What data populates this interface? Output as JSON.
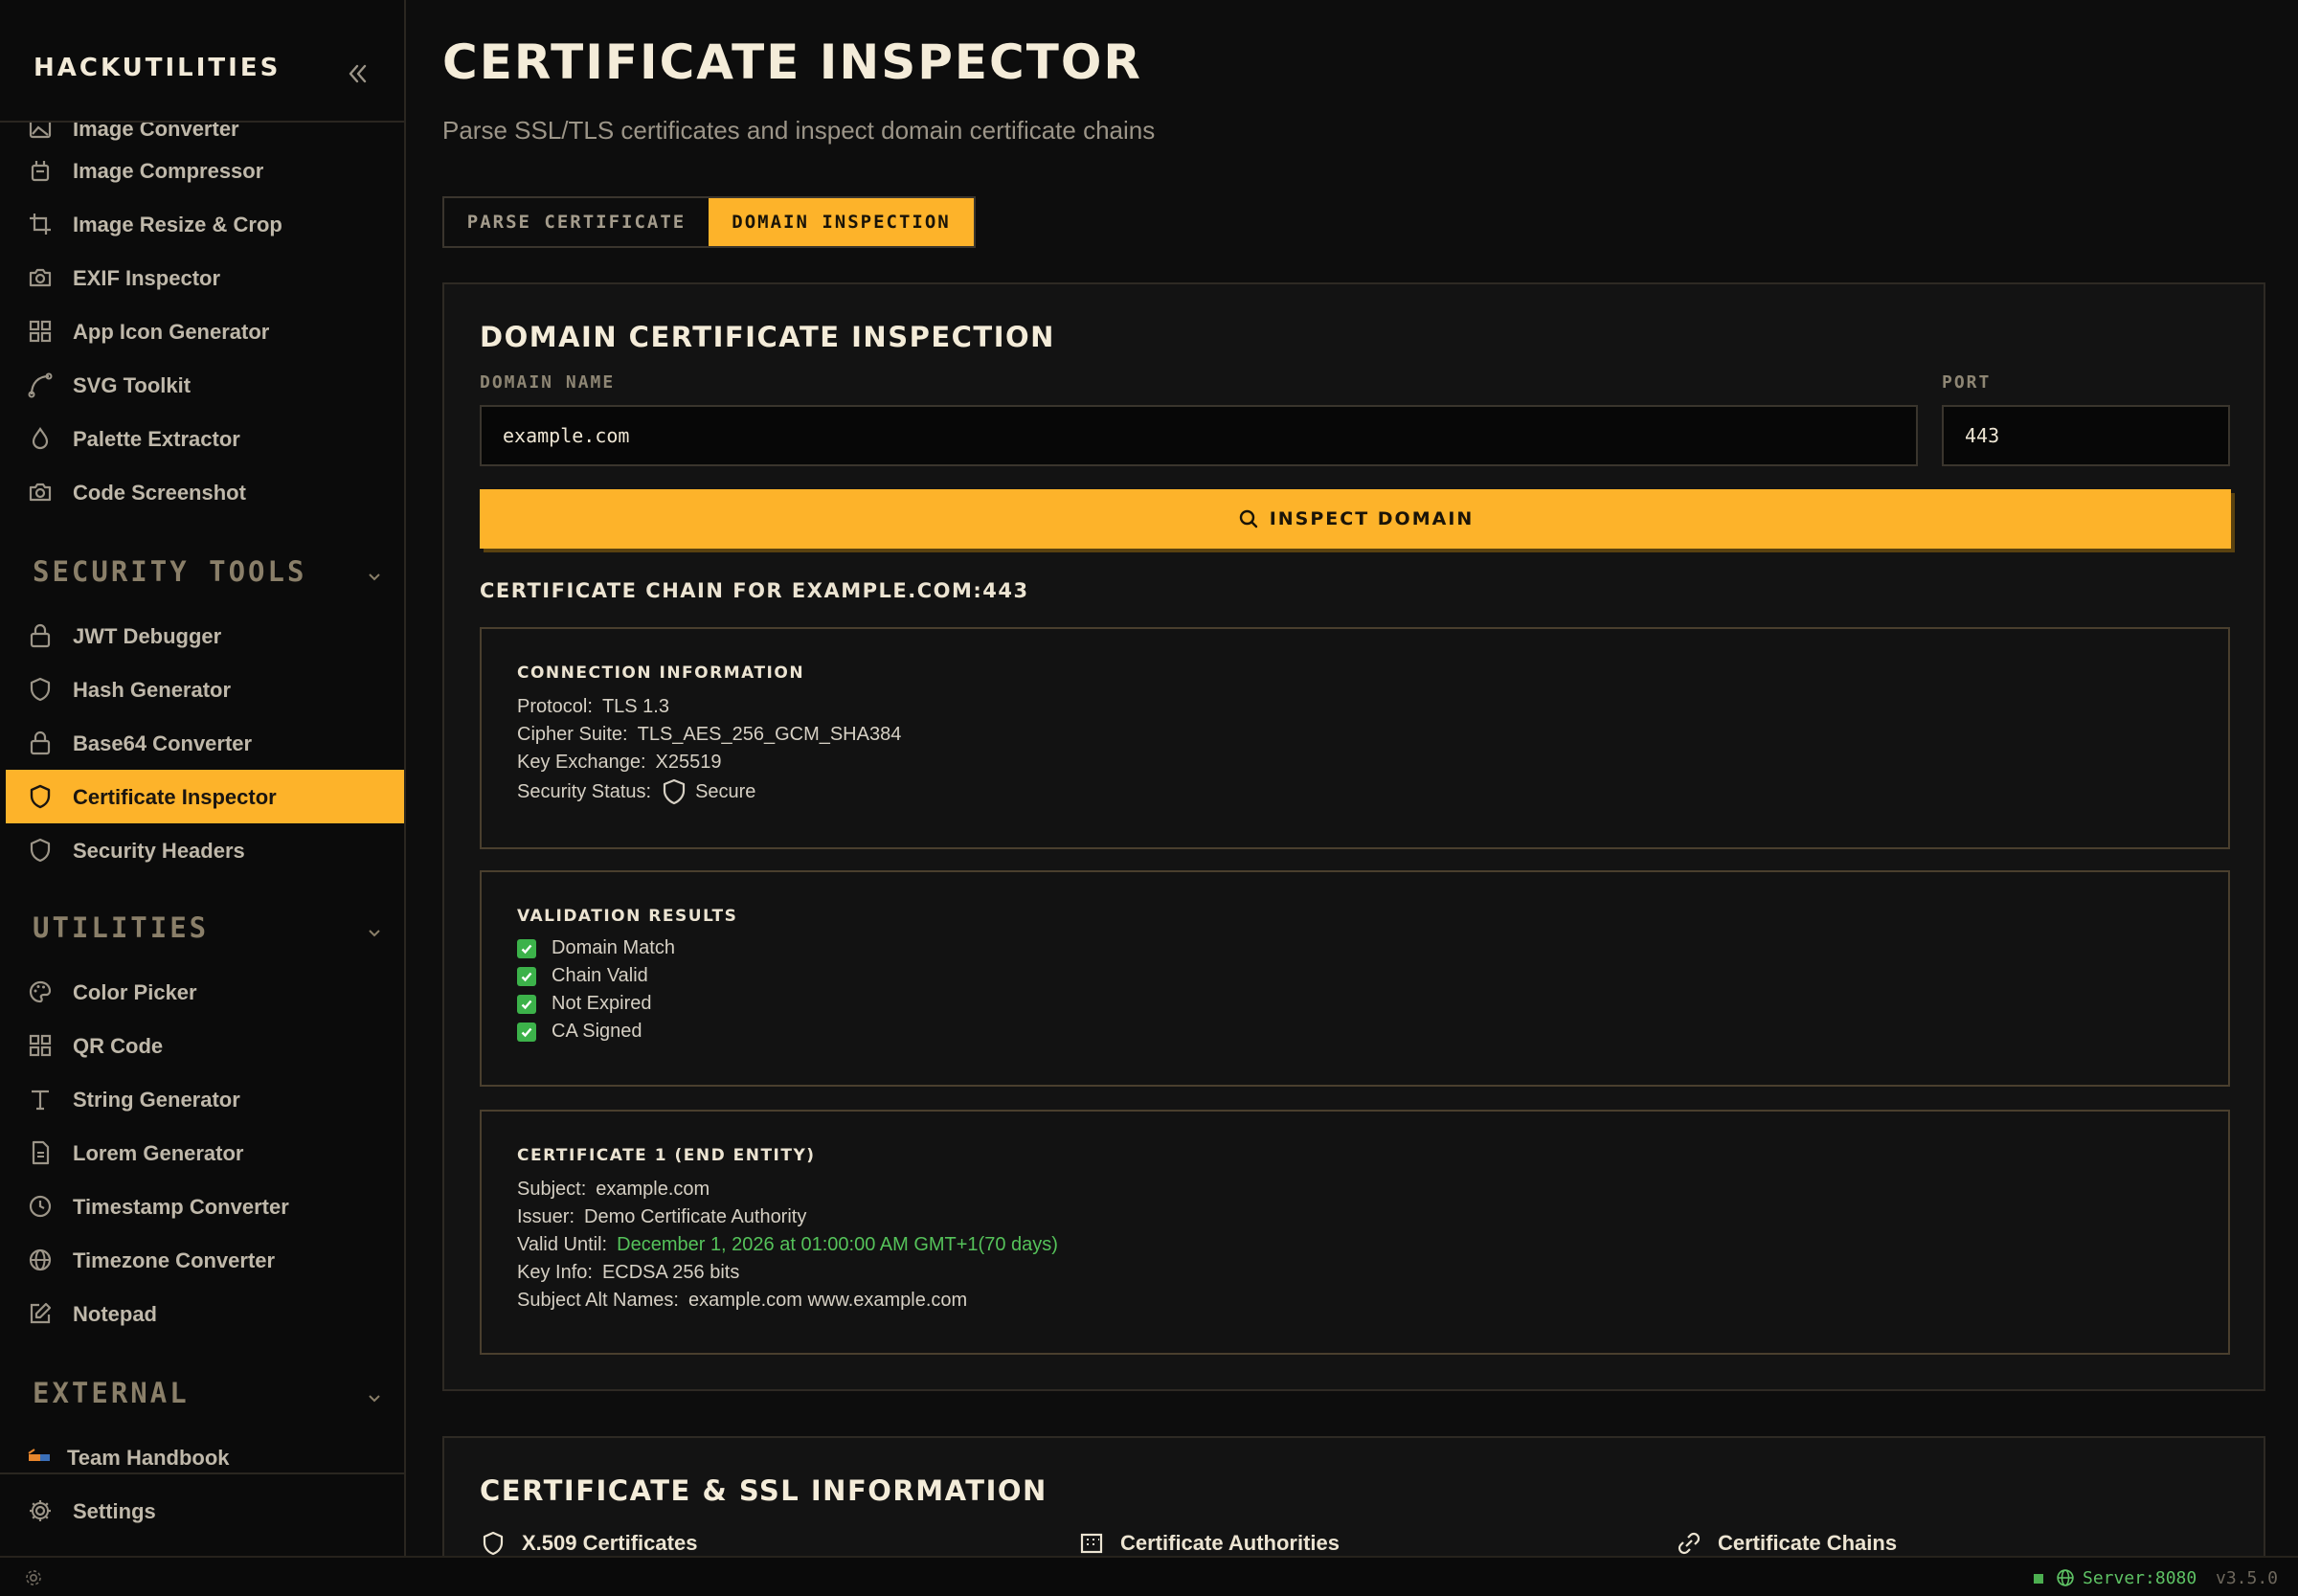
{
  "brand": "HACKUTILITIES",
  "sidebar": {
    "partial_item": "Image Converter",
    "image_items": [
      {
        "label": "Image Compressor",
        "icon": "compress-icon"
      },
      {
        "label": "Image Resize & Crop",
        "icon": "crop-icon"
      },
      {
        "label": "EXIF Inspector",
        "icon": "camera-icon"
      },
      {
        "label": "App Icon Generator",
        "icon": "grid-icon"
      },
      {
        "label": "SVG Toolkit",
        "icon": "bezier-icon"
      },
      {
        "label": "Palette Extractor",
        "icon": "droplet-icon"
      },
      {
        "label": "Code Screenshot",
        "icon": "camera-icon"
      }
    ],
    "security_header": "SECURITY TOOLS",
    "security_items": [
      {
        "label": "JWT Debugger",
        "icon": "lock-icon"
      },
      {
        "label": "Hash Generator",
        "icon": "shield-icon"
      },
      {
        "label": "Base64 Converter",
        "icon": "lock-icon"
      },
      {
        "label": "Certificate Inspector",
        "icon": "shield-icon",
        "active": true
      },
      {
        "label": "Security Headers",
        "icon": "shield-icon"
      }
    ],
    "utilities_header": "UTILITIES",
    "utilities_items": [
      {
        "label": "Color Picker",
        "icon": "palette-icon"
      },
      {
        "label": "QR Code",
        "icon": "qr-icon"
      },
      {
        "label": "String Generator",
        "icon": "type-icon"
      },
      {
        "label": "Lorem Generator",
        "icon": "document-icon"
      },
      {
        "label": "Timestamp Converter",
        "icon": "clock-icon"
      },
      {
        "label": "Timezone Converter",
        "icon": "globe-icon"
      },
      {
        "label": "Notepad",
        "icon": "edit-icon"
      }
    ],
    "external_header": "EXTERNAL",
    "external_items": [
      {
        "label": "Team Handbook",
        "icon": "handbook-icon"
      }
    ],
    "settings_label": "Settings"
  },
  "page": {
    "title": "CERTIFICATE INSPECTOR",
    "subtitle": "Parse SSL/TLS certificates and inspect domain certificate chains"
  },
  "tabs": [
    {
      "label": "PARSE CERTIFICATE",
      "active": false
    },
    {
      "label": "DOMAIN INSPECTION",
      "active": true
    }
  ],
  "domain_panel": {
    "title": "DOMAIN CERTIFICATE INSPECTION",
    "domain_label": "DOMAIN NAME",
    "domain_value": "example.com",
    "port_label": "PORT",
    "port_value": "443",
    "inspect_label": "INSPECT DOMAIN",
    "chain_title": "CERTIFICATE CHAIN FOR EXAMPLE.COM:443"
  },
  "connection": {
    "title": "CONNECTION INFORMATION",
    "protocol_key": "Protocol:",
    "protocol_val": "TLS 1.3",
    "cipher_key": "Cipher Suite:",
    "cipher_val": "TLS_AES_256_GCM_SHA384",
    "kex_key": "Key Exchange:",
    "kex_val": "X25519",
    "status_key": "Security Status:",
    "status_val": "Secure"
  },
  "validation": {
    "title": "VALIDATION RESULTS",
    "items": [
      "Domain Match",
      "Chain Valid",
      "Not Expired",
      "CA Signed"
    ]
  },
  "certificate": {
    "title": "CERTIFICATE 1 (END ENTITY)",
    "subject_key": "Subject:",
    "subject_val": "example.com",
    "issuer_key": "Issuer:",
    "issuer_val": "Demo Certificate Authority",
    "valid_key": "Valid Until:",
    "valid_val": "December 1, 2026 at 01:00:00 AM GMT+1(70 days)",
    "keyinfo_key": "Key Info:",
    "keyinfo_val": "ECDSA 256 bits",
    "san_key": "Subject Alt Names:",
    "san_val": "example.com www.example.com"
  },
  "info_panel": {
    "title": "CERTIFICATE & SSL INFORMATION",
    "columns": [
      "X.509 Certificates",
      "Certificate Authorities",
      "Certificate Chains"
    ]
  },
  "statusbar": {
    "server": "Server:8080",
    "version": "v3.5.0"
  },
  "colors": {
    "accent": "#fdb32a",
    "valid_green": "#55c25a",
    "server_green": "#5ec264"
  }
}
